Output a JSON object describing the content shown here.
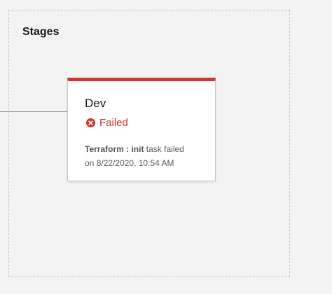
{
  "section": {
    "title": "Stages"
  },
  "stage": {
    "name": "Dev",
    "status": "Failed",
    "status_icon": "error-circle-icon",
    "status_color": "#cd3a2c",
    "accent_color": "#d13438",
    "task_name": "Terraform : init",
    "task_message": "task failed",
    "timestamp_prefix": "on",
    "timestamp": "8/22/2020, 10:54 AM"
  }
}
